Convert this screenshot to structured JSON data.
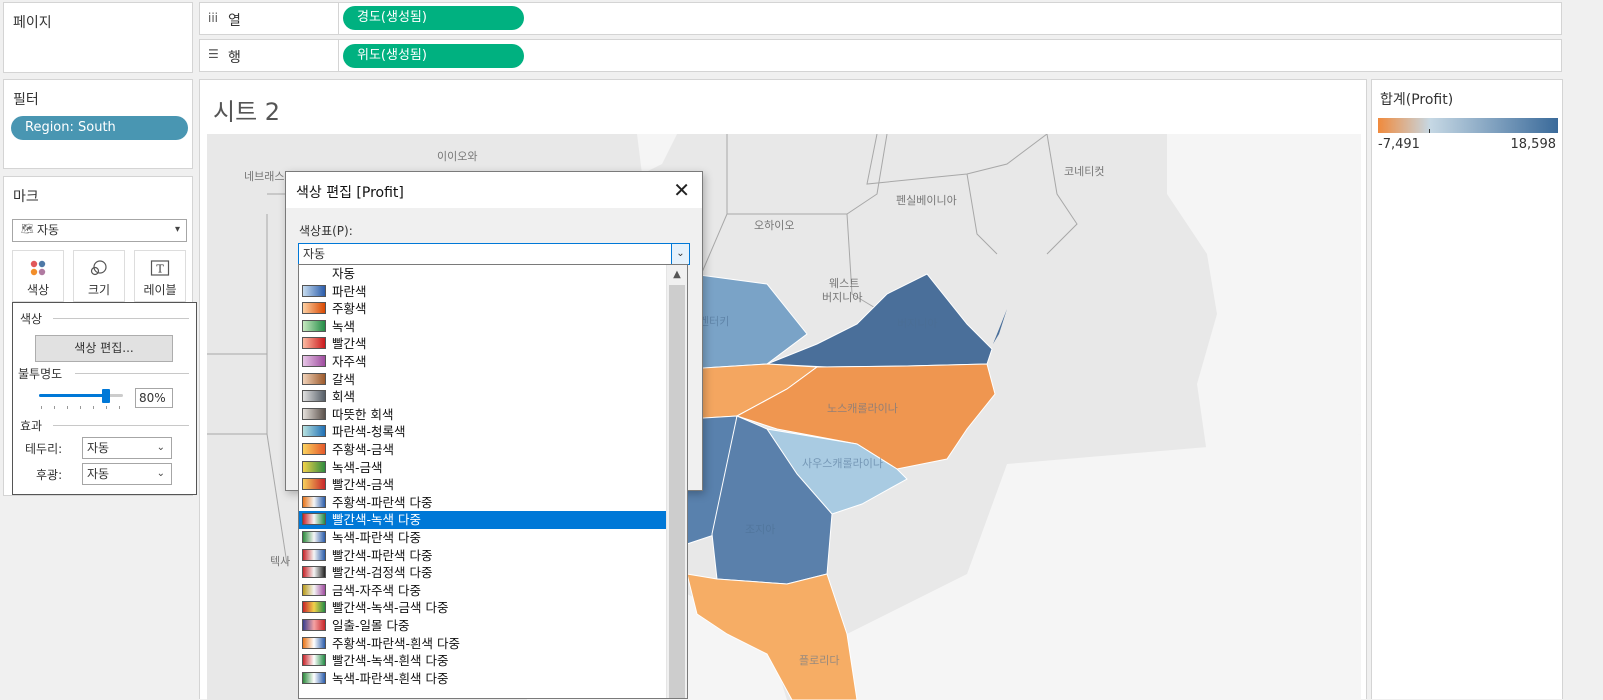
{
  "pages_panel": {
    "title": "페이지"
  },
  "columns_shelf": {
    "icon": "iii",
    "label": "열",
    "pill": "경도(생성됨)"
  },
  "rows_shelf": {
    "icon": "☰",
    "label": "행",
    "pill": "위도(생성됨)"
  },
  "filters": {
    "title": "필터",
    "pill": "Region: South"
  },
  "marks": {
    "title": "마크",
    "type_select": "자동",
    "buttons": [
      {
        "label": "색상"
      },
      {
        "label": "크기"
      },
      {
        "label": "레이블"
      }
    ],
    "color_popup": {
      "color_section": "색상",
      "edit_color_button": "색상 편집...",
      "opacity_section": "불투명도",
      "opacity_value": "80%",
      "opacity_fraction": 0.8,
      "effects_section": "효과",
      "border_label": "테두리:",
      "border_value": "자동",
      "halo_label": "후광:",
      "halo_value": "자동"
    }
  },
  "sheet": {
    "title": "시트 2"
  },
  "map_labels": {
    "ohio_label": "이이오와",
    "nebraska_label": "네브래스",
    "ohio": "오하이오",
    "pennsylvania": "펜실베이니아",
    "connecticut": "코네티컷",
    "west_virginia_1": "웨스트",
    "west_virginia_2": "버지니아",
    "virginia": "버지니아",
    "kentucky": "켄터키",
    "north_carolina": "노스캐롤라이나",
    "south_carolina": "사우스캐롤라이나",
    "georgia": "조지아",
    "texas": "텍사",
    "florida": "플로리다"
  },
  "legend": {
    "title": "합계(Profit)",
    "min": "-7,491",
    "max": "18,598",
    "colors": {
      "negative": "#f08a3c",
      "zero": "#c6d8e4",
      "positive": "#3a6a9a"
    }
  },
  "dialog": {
    "title": "색상 편집 [Profit]",
    "palette_label": "색상표(P):",
    "palette_value": "자동",
    "selected_index": 14,
    "palettes": [
      {
        "label": "자동",
        "colors": []
      },
      {
        "label": "파란색",
        "colors": [
          "#c7dcef",
          "#2a5caa"
        ]
      },
      {
        "label": "주황색",
        "colors": [
          "#fdd0a2",
          "#d94801"
        ]
      },
      {
        "label": "녹색",
        "colors": [
          "#c7e9c0",
          "#238b45"
        ]
      },
      {
        "label": "빨간색",
        "colors": [
          "#fcbba1",
          "#cb181d"
        ]
      },
      {
        "label": "자주색",
        "colors": [
          "#e7c6e7",
          "#9e4c9e"
        ]
      },
      {
        "label": "갈색",
        "colors": [
          "#f1d2b8",
          "#9c5a2c"
        ]
      },
      {
        "label": "회색",
        "colors": [
          "#e0e0e0",
          "#555d66"
        ]
      },
      {
        "label": "따뜻한 회색",
        "colors": [
          "#e6e1dc",
          "#5b514b"
        ]
      },
      {
        "label": "파란색-청록색",
        "colors": [
          "#b7e2e0",
          "#1f6fb4"
        ]
      },
      {
        "label": "주황색-금색",
        "colors": [
          "#fbd25e",
          "#e4582a"
        ]
      },
      {
        "label": "녹색-금색",
        "colors": [
          "#f1d24a",
          "#2e8b3e"
        ]
      },
      {
        "label": "빨간색-금색",
        "colors": [
          "#f7d05a",
          "#c8252a"
        ]
      },
      {
        "label": "주황색-파란색 다중",
        "colors": [
          "#e8751a",
          "#f5f5f5",
          "#2a5caa"
        ]
      },
      {
        "label": "빨간색-녹색 다중",
        "colors": [
          "#c8252a",
          "#f5f5f5",
          "#238b45"
        ]
      },
      {
        "label": "녹색-파란색 다중",
        "colors": [
          "#2e8b3e",
          "#f5f5f5",
          "#2a5caa"
        ]
      },
      {
        "label": "빨간색-파란색 다중",
        "colors": [
          "#c8252a",
          "#f5f5f5",
          "#2a5caa"
        ]
      },
      {
        "label": "빨간색-검정색 다중",
        "colors": [
          "#c8252a",
          "#f5f5f5",
          "#222222"
        ]
      },
      {
        "label": "금색-자주색 다중",
        "colors": [
          "#b89a1a",
          "#f5f5f5",
          "#9e4c9e"
        ]
      },
      {
        "label": "빨간색-녹색-금색 다중",
        "colors": [
          "#c8252a",
          "#f1d24a",
          "#238b45"
        ]
      },
      {
        "label": "일출-일몰 다중",
        "colors": [
          "#3a3f8f",
          "#f5a3a3",
          "#c8252a"
        ]
      },
      {
        "label": "주황색-파란색-흰색 다중",
        "colors": [
          "#e8751a",
          "#ffffff",
          "#2a5caa"
        ]
      },
      {
        "label": "빨간색-녹색-흰색 다중",
        "colors": [
          "#c8252a",
          "#ffffff",
          "#238b45"
        ]
      },
      {
        "label": "녹색-파란색-흰색 다중",
        "colors": [
          "#2e8b3e",
          "#ffffff",
          "#2a5caa"
        ]
      }
    ]
  }
}
